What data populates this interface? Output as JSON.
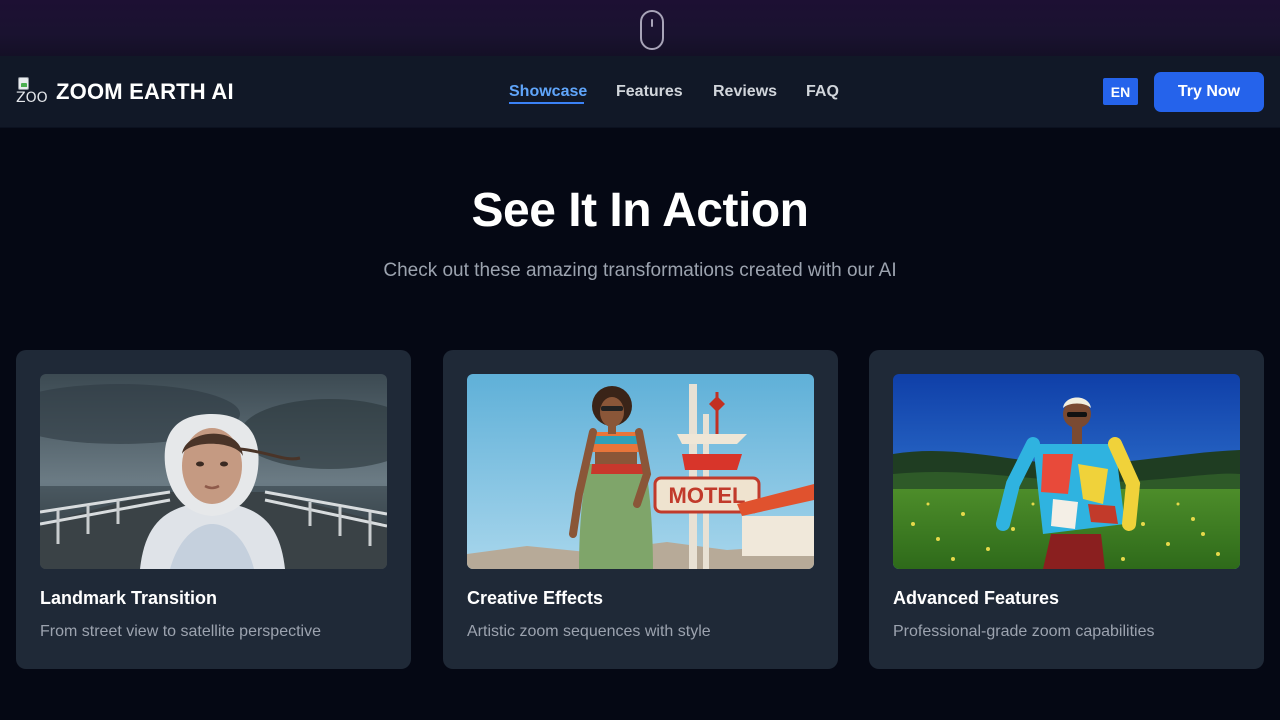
{
  "nav": {
    "brand_name": "ZOOM EARTH AI",
    "logo_alt": "ZOOM EARTH AI",
    "links": [
      "Showcase",
      "Features",
      "Reviews",
      "FAQ"
    ],
    "active_link": "Showcase",
    "lang_label": "EN",
    "cta_label": "Try Now"
  },
  "hero": {
    "title": "See It In Action",
    "subtitle": "Check out these amazing transformations created with our AI"
  },
  "cards": [
    {
      "title": "Landmark Transition",
      "description": "From street view to satellite perspective",
      "image_icon": "hooded-woman-on-pier-image"
    },
    {
      "title": "Creative Effects",
      "description": "Artistic zoom sequences with style",
      "image_icon": "woman-by-motel-sign-image",
      "sign_text": "MOTEL"
    },
    {
      "title": "Advanced Features",
      "description": "Professional-grade zoom capabilities",
      "image_icon": "man-in-meadow-image"
    }
  ],
  "colors": {
    "accent": "#2563eb",
    "active_link": "#60a5fa",
    "background": "#050814",
    "navbar": "#111827",
    "card": "#1f2937",
    "muted_text": "#9ca3af"
  }
}
